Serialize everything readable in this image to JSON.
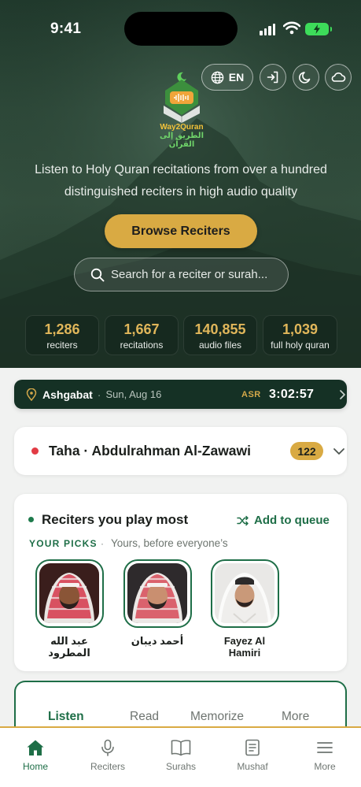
{
  "status_bar": {
    "time": "9:41"
  },
  "header": {
    "language": "EN"
  },
  "brand": {
    "name": "Way2Quran",
    "arabic_name": "الطريق إلى القرآن"
  },
  "hero": {
    "tagline": "Listen to Holy Quran recitations from over a hundred distinguished reciters in high audio quality",
    "browse_label": "Browse Reciters",
    "search_placeholder": "Search for a reciter or surah..."
  },
  "stats": [
    {
      "value": "1,286",
      "label": "reciters"
    },
    {
      "value": "1,667",
      "label": "recitations"
    },
    {
      "value": "140,855",
      "label": "audio files"
    },
    {
      "value": "1,039",
      "label": "full holy quran"
    }
  ],
  "prayer": {
    "city": "Ashgabat",
    "separator": "·",
    "date": "Sun, Aug 16",
    "prayer_name": "ASR",
    "countdown": "3:02:57"
  },
  "now_playing": {
    "title": "Taha · Abdulrahman Al-Zawawi",
    "count": "122"
  },
  "reciters_card": {
    "title": "Reciters you play most",
    "queue_label": "Add to queue",
    "picks_label": "YOUR PICKS",
    "picks_separator": "·",
    "picks_sub": "Yours, before everyone’s",
    "reciters": [
      {
        "name": "عبد الله المطرود"
      },
      {
        "name": "أحمد ديبان"
      },
      {
        "name": "Fayez Al Hamiri"
      }
    ]
  },
  "tabs": [
    {
      "label": "Listen"
    },
    {
      "label": "Read"
    },
    {
      "label": "Memorize"
    },
    {
      "label": "More"
    }
  ],
  "bottom_nav": [
    {
      "label": "Home",
      "icon": "home-icon"
    },
    {
      "label": "Reciters",
      "icon": "microphone-icon"
    },
    {
      "label": "Surahs",
      "icon": "book-icon"
    },
    {
      "label": "Mushaf",
      "icon": "mushaf-icon"
    },
    {
      "label": "More",
      "icon": "menu-icon"
    }
  ],
  "colors": {
    "accent_gold": "#d9aa43",
    "brand_green": "#1e6e47",
    "prayer_bar": "#153125",
    "live_dot": "#e23b44"
  }
}
